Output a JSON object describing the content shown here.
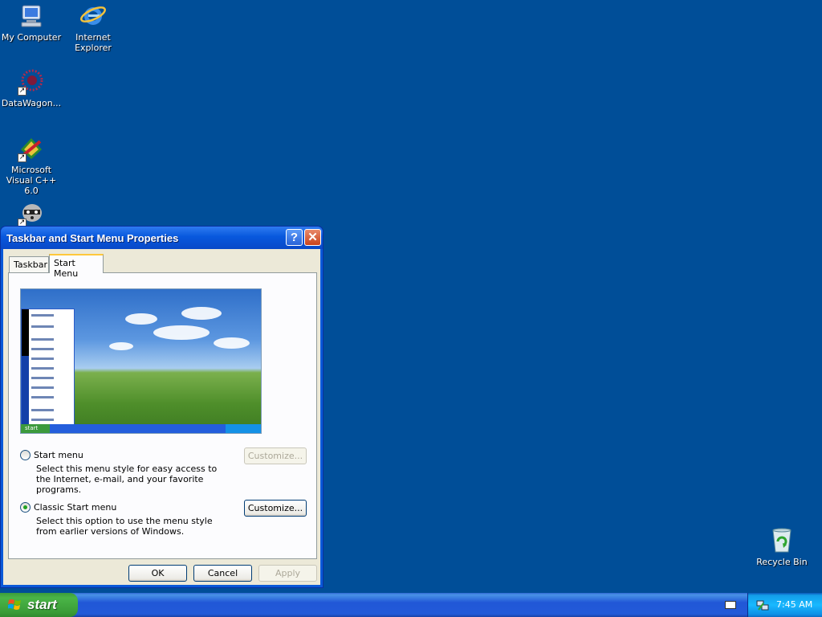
{
  "desktop": {
    "icons": [
      {
        "label": "My Computer",
        "icon": "my-computer-icon"
      },
      {
        "label": "Internet Explorer",
        "icon": "internet-explorer-icon"
      },
      {
        "label": "DataWagon...",
        "icon": "datawagon-icon"
      },
      {
        "label": "Microsoft Visual C++ 6.0",
        "icon": "visual-cpp-icon"
      },
      {
        "label": "",
        "icon": "raccoon-icon"
      },
      {
        "label": "Recycle Bin",
        "icon": "recycle-bin-icon"
      }
    ]
  },
  "dialog": {
    "title": "Taskbar and Start Menu Properties",
    "help_glyph": "?",
    "close_glyph": "✕",
    "tabs": [
      {
        "label": "Taskbar",
        "active": false
      },
      {
        "label": "Start Menu",
        "active": true
      }
    ],
    "options": [
      {
        "label": "Start menu",
        "description": "Select this menu style for easy access to the Internet, e-mail, and your favorite programs.",
        "selected": false,
        "customize_label": "Customize...",
        "customize_enabled": false
      },
      {
        "label": "Classic Start menu",
        "description": "Select this option to use the menu style from earlier versions of Windows.",
        "selected": true,
        "customize_label": "Customize...",
        "customize_enabled": true
      }
    ],
    "buttons": {
      "ok": "OK",
      "cancel": "Cancel",
      "apply": "Apply"
    },
    "preview": {
      "start_label": "start"
    }
  },
  "taskbar": {
    "start_label": "start",
    "clock": "7:45 AM"
  },
  "colors": {
    "desktop": "#004E98",
    "taskbar": "#245EDC",
    "start_button": "#3C9B3C",
    "tray": "#0F8EE5"
  }
}
